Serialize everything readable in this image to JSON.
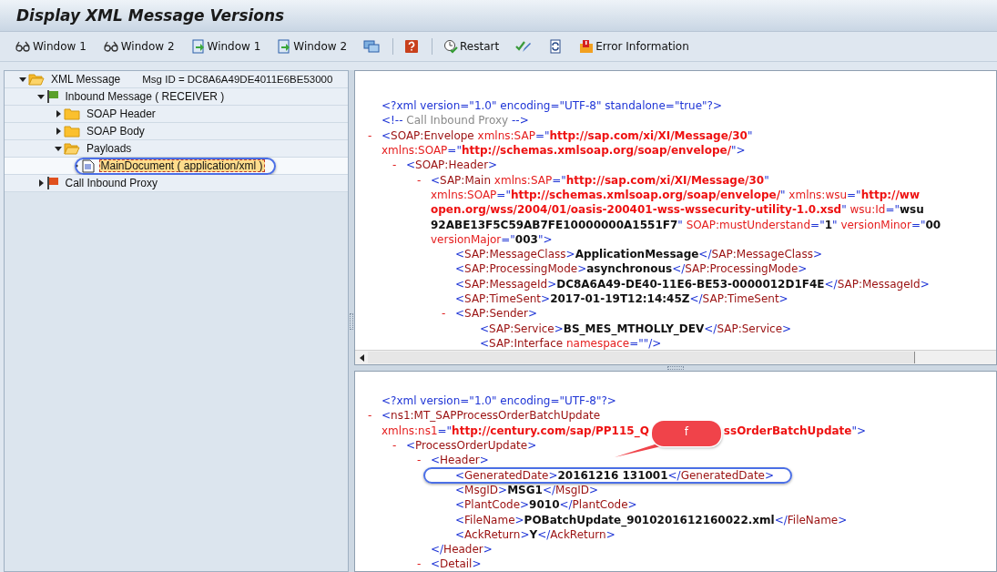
{
  "window": {
    "title": "Display XML Message Versions"
  },
  "toolbar": [
    {
      "kind": "glasses",
      "label": "Window 1"
    },
    {
      "kind": "glasses",
      "label": "Window 2"
    },
    {
      "kind": "doc-arrow",
      "label": "Window 1"
    },
    {
      "kind": "doc-arrow",
      "label": "Window 2"
    },
    {
      "kind": "screens"
    },
    {
      "kind": "separator"
    },
    {
      "kind": "help"
    },
    {
      "kind": "separator"
    },
    {
      "kind": "restart",
      "label": "Restart"
    },
    {
      "kind": "check"
    },
    {
      "kind": "refresh"
    },
    {
      "kind": "error",
      "label": "Error Information"
    }
  ],
  "tree": [
    {
      "label": "XML Message",
      "kind": "folder-open",
      "expanded": true,
      "selected": false,
      "msg_id": "Msg ID =  DC8A6A49DE4011E6BE53000",
      "children": [
        {
          "label": "Inbound Message ( RECEIVER )",
          "kind": "flag",
          "color": "#5aa02c",
          "expanded": true,
          "selected": false,
          "children": [
            {
              "label": "SOAP Header",
              "kind": "folder",
              "expanded": false,
              "selected": false
            },
            {
              "label": "SOAP Body",
              "kind": "folder",
              "expanded": false,
              "selected": false
            },
            {
              "label": "Payloads",
              "kind": "folder-open",
              "expanded": true,
              "selected": false,
              "children": [
                {
                  "label": "MainDocument ( application/xml )",
                  "kind": "document",
                  "selected": true,
                  "highlighted": true
                }
              ]
            }
          ]
        },
        {
          "label": "Call Inbound Proxy",
          "kind": "flag",
          "color": "#e0501e",
          "expanded": false,
          "selected": false
        }
      ]
    }
  ],
  "message_pane": {
    "nodes": [
      {
        "lines": [
          [
            {
              "kind": "pi",
              "text": "<?xml version=\"1.0\" encoding=\"UTF-8\" standalone=\"true\"?>"
            }
          ]
        ]
      },
      {
        "lines": [
          [
            {
              "kind": "p",
              "text": "<!--"
            },
            {
              "kind": "c",
              "text": " Call Inbound Proxy "
            },
            {
              "kind": "p",
              "text": "-->"
            }
          ]
        ]
      },
      {
        "toggle": "-",
        "lines": [
          [
            {
              "kind": "p",
              "text": "<"
            },
            {
              "kind": "t",
              "text": "SOAP:Envelope"
            },
            {
              "kind": "a",
              "text": " xmlns:SAP"
            },
            {
              "kind": "p",
              "text": "=\""
            },
            {
              "kind": "v",
              "text": "http://sap.com/xi/XI/Message/30"
            },
            {
              "kind": "p",
              "text": "\""
            }
          ],
          [
            {
              "kind": "a",
              "text": "xmlns:SOAP"
            },
            {
              "kind": "p",
              "text": "=\""
            },
            {
              "kind": "v",
              "text": "http://schemas.xmlsoap.org/soap/envelope/"
            },
            {
              "kind": "p",
              "text": "\">"
            }
          ]
        ],
        "children": [
          {
            "toggle": "-",
            "lines": [
              [
                {
                  "kind": "p",
                  "text": "<"
                },
                {
                  "kind": "t",
                  "text": "SOAP:Header"
                },
                {
                  "kind": "p",
                  "text": ">"
                }
              ]
            ],
            "children": [
              {
                "toggle": "-",
                "lines": [
                  [
                    {
                      "kind": "p",
                      "text": "<"
                    },
                    {
                      "kind": "t",
                      "text": "SAP:Main"
                    },
                    {
                      "kind": "a",
                      "text": " xmlns:SAP"
                    },
                    {
                      "kind": "p",
                      "text": "=\""
                    },
                    {
                      "kind": "v",
                      "text": "http://sap.com/xi/XI/Message/30"
                    },
                    {
                      "kind": "p",
                      "text": "\""
                    }
                  ],
                  [
                    {
                      "kind": "a",
                      "text": "xmlns:SOAP"
                    },
                    {
                      "kind": "p",
                      "text": "=\""
                    },
                    {
                      "kind": "v",
                      "text": "http://schemas.xmlsoap.org/soap/envelope/"
                    },
                    {
                      "kind": "p",
                      "text": "\""
                    },
                    {
                      "kind": "a",
                      "text": " xmlns:wsu"
                    },
                    {
                      "kind": "p",
                      "text": "=\""
                    },
                    {
                      "kind": "v",
                      "text": "http://ww"
                    }
                  ],
                  [
                    {
                      "kind": "v",
                      "text": "open.org/wss/2004/01/oasis-200401-wss-wssecurity-utility-1.0.xsd"
                    },
                    {
                      "kind": "p",
                      "text": "\""
                    },
                    {
                      "kind": "a",
                      "text": " wsu:Id"
                    },
                    {
                      "kind": "p",
                      "text": "=\""
                    },
                    {
                      "kind": "x",
                      "text": "wsu"
                    }
                  ],
                  [
                    {
                      "kind": "x",
                      "text": "92ABE13F5C59AB7FE10000000A1551F7"
                    },
                    {
                      "kind": "p",
                      "text": "\""
                    },
                    {
                      "kind": "a",
                      "text": " SOAP:mustUnderstand"
                    },
                    {
                      "kind": "p",
                      "text": "=\""
                    },
                    {
                      "kind": "x",
                      "text": "1"
                    },
                    {
                      "kind": "p",
                      "text": "\""
                    },
                    {
                      "kind": "a",
                      "text": " versionMinor"
                    },
                    {
                      "kind": "p",
                      "text": "=\""
                    },
                    {
                      "kind": "x",
                      "text": "00"
                    }
                  ],
                  [
                    {
                      "kind": "a",
                      "text": "versionMajor"
                    },
                    {
                      "kind": "p",
                      "text": "=\""
                    },
                    {
                      "kind": "x",
                      "text": "003"
                    },
                    {
                      "kind": "p",
                      "text": "\">"
                    }
                  ]
                ],
                "children": [
                  {
                    "lines": [
                      [
                        {
                          "kind": "p",
                          "text": "<"
                        },
                        {
                          "kind": "t",
                          "text": "SAP:MessageClass"
                        },
                        {
                          "kind": "p",
                          "text": ">"
                        },
                        {
                          "kind": "x",
                          "text": "ApplicationMessage"
                        },
                        {
                          "kind": "p",
                          "text": "</"
                        },
                        {
                          "kind": "t",
                          "text": "SAP:MessageClass"
                        },
                        {
                          "kind": "p",
                          "text": ">"
                        }
                      ]
                    ]
                  },
                  {
                    "lines": [
                      [
                        {
                          "kind": "p",
                          "text": "<"
                        },
                        {
                          "kind": "t",
                          "text": "SAP:ProcessingMode"
                        },
                        {
                          "kind": "p",
                          "text": ">"
                        },
                        {
                          "kind": "x",
                          "text": "asynchronous"
                        },
                        {
                          "kind": "p",
                          "text": "</"
                        },
                        {
                          "kind": "t",
                          "text": "SAP:ProcessingMode"
                        },
                        {
                          "kind": "p",
                          "text": ">"
                        }
                      ]
                    ]
                  },
                  {
                    "lines": [
                      [
                        {
                          "kind": "p",
                          "text": "<"
                        },
                        {
                          "kind": "t",
                          "text": "SAP:MessageId"
                        },
                        {
                          "kind": "p",
                          "text": ">"
                        },
                        {
                          "kind": "x",
                          "text": "DC8A6A49-DE40-11E6-BE53-0000012D1F4E"
                        },
                        {
                          "kind": "p",
                          "text": "</"
                        },
                        {
                          "kind": "t",
                          "text": "SAP:MessageId"
                        },
                        {
                          "kind": "p",
                          "text": ">"
                        }
                      ]
                    ]
                  },
                  {
                    "lines": [
                      [
                        {
                          "kind": "p",
                          "text": "<"
                        },
                        {
                          "kind": "t",
                          "text": "SAP:TimeSent"
                        },
                        {
                          "kind": "p",
                          "text": ">"
                        },
                        {
                          "kind": "x",
                          "text": "2017-01-19T12:14:45Z"
                        },
                        {
                          "kind": "p",
                          "text": "</"
                        },
                        {
                          "kind": "t",
                          "text": "SAP:TimeSent"
                        },
                        {
                          "kind": "p",
                          "text": ">"
                        }
                      ]
                    ]
                  },
                  {
                    "toggle": "-",
                    "lines": [
                      [
                        {
                          "kind": "p",
                          "text": "<"
                        },
                        {
                          "kind": "t",
                          "text": "SAP:Sender"
                        },
                        {
                          "kind": "p",
                          "text": ">"
                        }
                      ]
                    ],
                    "children": [
                      {
                        "lines": [
                          [
                            {
                              "kind": "p",
                              "text": "<"
                            },
                            {
                              "kind": "t",
                              "text": "SAP:Service"
                            },
                            {
                              "kind": "p",
                              "text": ">"
                            },
                            {
                              "kind": "x",
                              "text": "BS_MES_MTHOLLY_DEV"
                            },
                            {
                              "kind": "p",
                              "text": "</"
                            },
                            {
                              "kind": "t",
                              "text": "SAP:Service"
                            },
                            {
                              "kind": "p",
                              "text": ">"
                            }
                          ]
                        ]
                      },
                      {
                        "lines": [
                          [
                            {
                              "kind": "p",
                              "text": "<"
                            },
                            {
                              "kind": "t",
                              "text": "SAP:Interface"
                            },
                            {
                              "kind": "a",
                              "text": " namespace"
                            },
                            {
                              "kind": "p",
                              "text": "=\"\"/>"
                            }
                          ]
                        ]
                      }
                    ]
                  }
                ]
              }
            ]
          }
        ]
      }
    ]
  },
  "payload_pane": {
    "nodes": [
      {
        "lines": [
          [
            {
              "kind": "pi",
              "text": "<?xml version=\"1.0\" encoding=\"UTF-8\"?>"
            }
          ]
        ]
      },
      {
        "toggle": "-",
        "lines": [
          [
            {
              "kind": "p",
              "text": "<"
            },
            {
              "kind": "t",
              "text": "ns1:MT_SAPProcessOrderBatchUpdate"
            }
          ],
          [
            {
              "kind": "a",
              "text": "xmlns:ns1"
            },
            {
              "kind": "p",
              "text": "=\""
            },
            {
              "kind": "v",
              "text": "http://century.com/sap/PP115_Q"
            },
            {
              "kind": "callout",
              "text": "f"
            },
            {
              "kind": "v",
              "text": "ssOrderBatchUpdate"
            },
            {
              "kind": "p",
              "text": "\">"
            }
          ]
        ],
        "children": [
          {
            "toggle": "-",
            "lines": [
              [
                {
                  "kind": "p",
                  "text": "<"
                },
                {
                  "kind": "t",
                  "text": "ProcessOrderUpdate"
                },
                {
                  "kind": "p",
                  "text": ">"
                }
              ]
            ],
            "children": [
              {
                "toggle": "-",
                "lines": [
                  [
                    {
                      "kind": "p",
                      "text": "<"
                    },
                    {
                      "kind": "t",
                      "text": "Header"
                    },
                    {
                      "kind": "p",
                      "text": ">"
                    }
                  ]
                ],
                "children": [
                  {
                    "highlighted": true,
                    "lines": [
                      [
                        {
                          "kind": "p",
                          "text": "<"
                        },
                        {
                          "kind": "t",
                          "text": "GeneratedDate"
                        },
                        {
                          "kind": "p",
                          "text": ">"
                        },
                        {
                          "kind": "x",
                          "text": "20161216 131001"
                        },
                        {
                          "kind": "p",
                          "text": "</"
                        },
                        {
                          "kind": "t",
                          "text": "GeneratedDate"
                        },
                        {
                          "kind": "p",
                          "text": ">"
                        }
                      ]
                    ]
                  },
                  {
                    "lines": [
                      [
                        {
                          "kind": "p",
                          "text": "<"
                        },
                        {
                          "kind": "t",
                          "text": "MsgID"
                        },
                        {
                          "kind": "p",
                          "text": ">"
                        },
                        {
                          "kind": "x",
                          "text": "MSG1"
                        },
                        {
                          "kind": "p",
                          "text": "</"
                        },
                        {
                          "kind": "t",
                          "text": "MsgID"
                        },
                        {
                          "kind": "p",
                          "text": ">"
                        }
                      ]
                    ]
                  },
                  {
                    "lines": [
                      [
                        {
                          "kind": "p",
                          "text": "<"
                        },
                        {
                          "kind": "t",
                          "text": "PlantCode"
                        },
                        {
                          "kind": "p",
                          "text": ">"
                        },
                        {
                          "kind": "x",
                          "text": "9010"
                        },
                        {
                          "kind": "p",
                          "text": "</"
                        },
                        {
                          "kind": "t",
                          "text": "PlantCode"
                        },
                        {
                          "kind": "p",
                          "text": ">"
                        }
                      ]
                    ]
                  },
                  {
                    "lines": [
                      [
                        {
                          "kind": "p",
                          "text": "<"
                        },
                        {
                          "kind": "t",
                          "text": "FileName"
                        },
                        {
                          "kind": "p",
                          "text": ">"
                        },
                        {
                          "kind": "x",
                          "text": "POBatchUpdate_9010201612160022.xml"
                        },
                        {
                          "kind": "p",
                          "text": "</"
                        },
                        {
                          "kind": "t",
                          "text": "FileName"
                        },
                        {
                          "kind": "p",
                          "text": ">"
                        }
                      ]
                    ]
                  },
                  {
                    "lines": [
                      [
                        {
                          "kind": "p",
                          "text": "<"
                        },
                        {
                          "kind": "t",
                          "text": "AckReturn"
                        },
                        {
                          "kind": "p",
                          "text": ">"
                        },
                        {
                          "kind": "x",
                          "text": "Y"
                        },
                        {
                          "kind": "p",
                          "text": "</"
                        },
                        {
                          "kind": "t",
                          "text": "AckReturn"
                        },
                        {
                          "kind": "p",
                          "text": ">"
                        }
                      ]
                    ]
                  }
                ],
                "closing": [
                  [
                    {
                      "kind": "p",
                      "text": "</"
                    },
                    {
                      "kind": "t",
                      "text": "Header"
                    },
                    {
                      "kind": "p",
                      "text": ">"
                    }
                  ]
                ]
              },
              {
                "toggle": "-",
                "lines": [
                  [
                    {
                      "kind": "p",
                      "text": "<"
                    },
                    {
                      "kind": "t",
                      "text": "Detail"
                    },
                    {
                      "kind": "p",
                      "text": ">"
                    }
                  ]
                ]
              }
            ]
          }
        ]
      }
    ]
  }
}
